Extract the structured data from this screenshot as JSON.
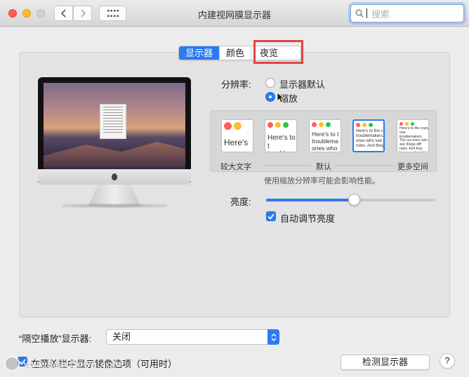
{
  "window": {
    "title": "内建视网膜显示器",
    "search_placeholder": "搜索"
  },
  "tabs": [
    {
      "label": "显示器",
      "active": true
    },
    {
      "label": "颜色",
      "active": false
    },
    {
      "label": "夜览",
      "active": false,
      "highlighted": true
    }
  ],
  "resolution": {
    "label": "分辨率:",
    "options": [
      {
        "label": "显示器默认",
        "selected": false
      },
      {
        "label": "缩放",
        "selected": true
      }
    ]
  },
  "scaling": {
    "thumbnails": [
      {
        "text": "Here's",
        "selected": false
      },
      {
        "text": "Here's to t troublem",
        "selected": false
      },
      {
        "text": "Here's to t troublema ones who",
        "selected": false
      },
      {
        "text": "Here's to the c troublemakers. ones who see t rules. And they",
        "selected": true
      },
      {
        "text": "Here's to the crazy one troublemakers. The rou ones who see things diff rules. And they have no about the status quo. Yo",
        "selected": false
      }
    ],
    "left_label": "较大文字",
    "middle_label": "默认",
    "right_label": "更多空间",
    "note": "使用缩放分辨率可能会影响性能。"
  },
  "brightness": {
    "label": "亮度:",
    "value": 0.52,
    "auto_label": "自动调节亮度",
    "auto_checked": true
  },
  "airplay": {
    "label": "“隔空播放”显示器:",
    "value": "关闭"
  },
  "mirror": {
    "label": "在菜单栏中显示镜像选项（可用时）",
    "checked": true
  },
  "detect_button": "检测显示器",
  "help_button": "?",
  "watermark": "www.MacDown.com",
  "colors": {
    "accent": "#2b7bf0",
    "highlight_box": "#e04545"
  }
}
